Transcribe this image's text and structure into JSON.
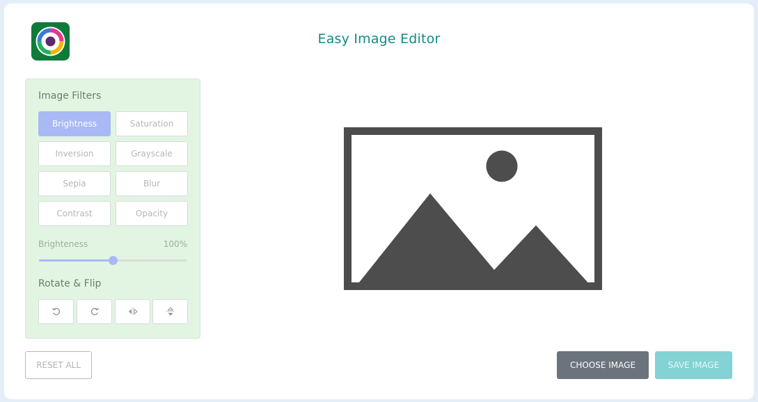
{
  "app": {
    "title": "Easy Image Editor",
    "logo_icon": "color-ring-icon"
  },
  "filters": {
    "heading": "Image Filters",
    "buttons": [
      {
        "label": "Brightness",
        "active": true
      },
      {
        "label": "Saturation",
        "active": false
      },
      {
        "label": "Inversion",
        "active": false
      },
      {
        "label": "Grayscale",
        "active": false
      },
      {
        "label": "Sepia",
        "active": false
      },
      {
        "label": "Blur",
        "active": false
      },
      {
        "label": "Contrast",
        "active": false
      },
      {
        "label": "Opacity",
        "active": false
      }
    ],
    "slider": {
      "label": "Brighteness",
      "value_text": "100%",
      "fraction": 0.5
    }
  },
  "rotate_flip": {
    "heading": "Rotate & Flip",
    "buttons": [
      {
        "icon": "rotate-left-icon"
      },
      {
        "icon": "rotate-right-icon"
      },
      {
        "icon": "flip-horizontal-icon"
      },
      {
        "icon": "flip-vertical-icon"
      }
    ]
  },
  "preview": {
    "icon": "image-placeholder-icon"
  },
  "actions": {
    "reset_label": "RESET ALL",
    "choose_label": "CHOOSE IMAGE",
    "save_label": "SAVE IMAGE"
  },
  "colors": {
    "accent": "#a9b9f5",
    "title": "#118a8a",
    "panel_bg": "#e2f5e3",
    "choose_bg": "#6b737d",
    "save_bg": "#83d2d4"
  }
}
